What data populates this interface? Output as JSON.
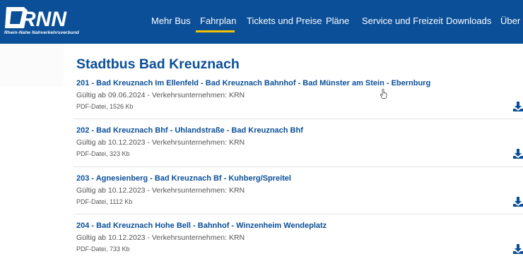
{
  "brand": {
    "logo_text": "RNN",
    "tagline": "Rhein-Nahe Nahverkehrsverbund",
    "colors": {
      "header": "#0a4f98",
      "accent": "#f2c100",
      "link": "#0a4f98"
    }
  },
  "nav": {
    "items": [
      {
        "label": "Mehr Bus"
      },
      {
        "label": "Fahrplan",
        "active": true
      },
      {
        "label": "Tickets und Preise"
      },
      {
        "label": "Pläne"
      },
      {
        "label": "Service und Freizeit"
      },
      {
        "label": "Downloads"
      },
      {
        "label": "Über d"
      }
    ]
  },
  "main": {
    "title": "Stadtbus Bad Kreuznach",
    "entries": [
      {
        "title": "201 - Bad Kreuznach Im Ellenfeld - Bad Kreuznach Bahnhof - Bad Münster am Stein - Ebernburg",
        "meta": "Gültig ab 09.06.2024 - Verkehrsunternehmen: KRN",
        "file": "PDF-Datei, 1526 Kb",
        "download_icon": "download-icon"
      },
      {
        "title": "202 - Bad Kreuznach Bhf - Uhlandstraße - Bad Kreuznach Bhf",
        "meta": "Gültig ab 10.12.2023 - Verkehrsunternehmen: KRN",
        "file": "PDF-Datei, 323 Kb",
        "download_icon": "download-icon"
      },
      {
        "title": "203 - Agnesienberg - Bad Kreuznach Bf - Kuhberg/Spreitel",
        "meta": "Gültig ab 10.12.2023 - Verkehrsunternehmen: KRN",
        "file": "PDF-Datei, 1112 Kb",
        "download_icon": "download-icon"
      },
      {
        "title": "204 - Bad Kreuznach Hohe Bell - Bahnhof - Winzenheim Wendeplatz",
        "meta": "Gültig ab 10.12.2023 - Verkehrsunternehmen: KRN",
        "file": "PDF-Datei, 733 Kb",
        "download_icon": "download-icon"
      }
    ]
  }
}
